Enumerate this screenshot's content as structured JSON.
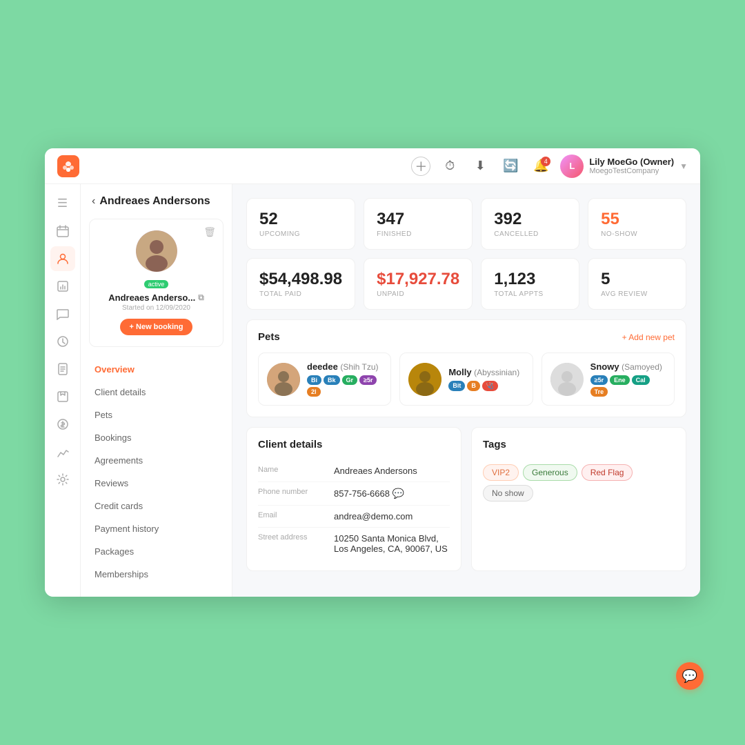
{
  "app": {
    "logo_char": "🐾",
    "user": {
      "name": "Lily MoeGo (Owner)",
      "company": "MoegoTestCompany",
      "avatar_initials": "L"
    },
    "topbar_icons": [
      "＋",
      "⏱",
      "⬇",
      "🔔"
    ],
    "notification_count": "4"
  },
  "sidebar": {
    "icons": [
      {
        "name": "menu-icon",
        "glyph": "☰"
      },
      {
        "name": "calendar-icon",
        "glyph": "📅"
      },
      {
        "name": "clients-icon",
        "glyph": "👤"
      },
      {
        "name": "reports-icon",
        "glyph": "📊"
      },
      {
        "name": "messages-icon",
        "glyph": "💬"
      },
      {
        "name": "reminders-icon",
        "glyph": "🔔"
      },
      {
        "name": "invoices-icon",
        "glyph": "🧾"
      },
      {
        "name": "packages-icon",
        "glyph": "📦"
      },
      {
        "name": "payroll-icon",
        "glyph": "💰"
      },
      {
        "name": "analytics-icon",
        "glyph": "📈"
      },
      {
        "name": "settings-icon",
        "glyph": "⚙"
      }
    ]
  },
  "client": {
    "back_label": "< Andreaes Andersons",
    "name": "Andreaes Anderso...",
    "started": "Started on 12/09/2020",
    "status": "active",
    "new_booking_label": "+ New booking"
  },
  "nav": {
    "items": [
      {
        "label": "Overview",
        "active": true
      },
      {
        "label": "Client details"
      },
      {
        "label": "Pets"
      },
      {
        "label": "Bookings"
      },
      {
        "label": "Agreements"
      },
      {
        "label": "Reviews"
      },
      {
        "label": "Credit cards"
      },
      {
        "label": "Payment history"
      },
      {
        "label": "Packages"
      },
      {
        "label": "Memberships"
      }
    ]
  },
  "stats": [
    {
      "value": "52",
      "label": "UPCOMING",
      "color": "normal"
    },
    {
      "value": "347",
      "label": "FINISHED",
      "color": "normal"
    },
    {
      "value": "392",
      "label": "CANCELLED",
      "color": "normal"
    },
    {
      "value": "55",
      "label": "NO-SHOW",
      "color": "orange"
    },
    {
      "value": "$54,498.98",
      "label": "TOTAL PAID",
      "color": "normal"
    },
    {
      "value": "$17,927.78",
      "label": "UNPAID",
      "color": "red"
    },
    {
      "value": "1,123",
      "label": "TOTAL APPTS",
      "color": "normal"
    },
    {
      "value": "5",
      "label": "AVG REVIEW",
      "color": "normal"
    }
  ],
  "pets": {
    "section_title": "Pets",
    "add_label": "+ Add new pet",
    "items": [
      {
        "name": "deedee",
        "breed": "Shih Tzu",
        "tags": [
          "B",
          "Bk",
          "Gr",
          "≥5r",
          "2l"
        ],
        "tag_colors": [
          "tag-b",
          "tag-b",
          "tag-g",
          "tag-p",
          "tag-o"
        ]
      },
      {
        "name": "Molly",
        "breed": "Abyssinian",
        "tags": [
          "Bit",
          "B",
          "🩺"
        ],
        "tag_colors": [
          "tag-b",
          "tag-o",
          "tag-r"
        ]
      },
      {
        "name": "Snowy",
        "breed": "Samoyed",
        "tags": [
          "≥5r",
          "Ene",
          "Cal",
          "Tre"
        ],
        "tag_colors": [
          "tag-b",
          "tag-g",
          "tag-teal",
          "tag-o"
        ]
      }
    ]
  },
  "client_details": {
    "section_title": "Client details",
    "fields": [
      {
        "label": "Name",
        "value": "Andreaes Andersons"
      },
      {
        "label": "Phone number",
        "value": "857-756-6668"
      },
      {
        "label": "Email",
        "value": "andrea@demo.com"
      },
      {
        "label": "Street address",
        "value": "10250 Santa Monica Blvd, Los Angeles, CA, 90067, US"
      }
    ]
  },
  "tags_section": {
    "section_title": "Tags",
    "tags": [
      {
        "label": "VIP2",
        "style": "tag-vip"
      },
      {
        "label": "Generous",
        "style": "tag-generous"
      },
      {
        "label": "Red Flag",
        "style": "tag-redflag"
      },
      {
        "label": "No show",
        "style": "tag-noshow"
      }
    ]
  }
}
